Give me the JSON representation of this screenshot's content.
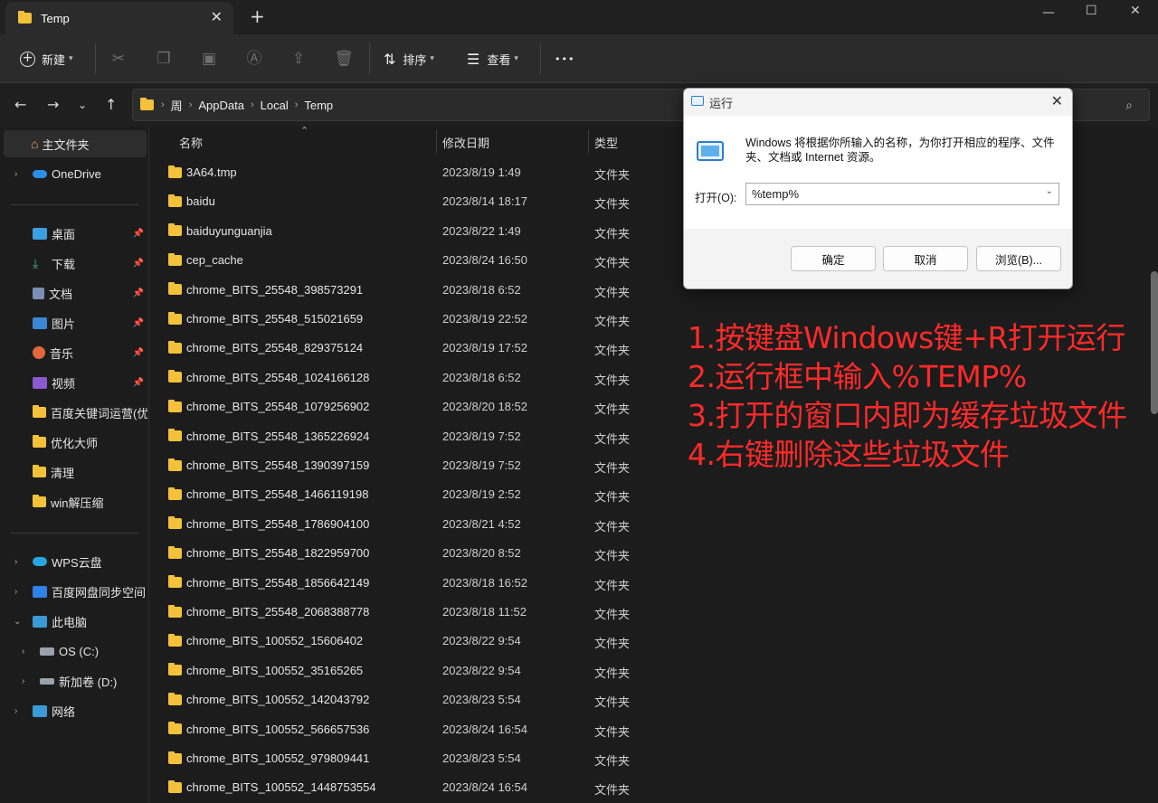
{
  "window": {
    "tab_title": "Temp",
    "tab_close": "✕",
    "new_tab": "+",
    "minimize": "—",
    "maximize": "☐",
    "close": "✕"
  },
  "toolbar": {
    "new_label": "新建",
    "sort_label": "排序",
    "view_label": "查看",
    "more": "•••"
  },
  "address": {
    "crumbs": [
      "周",
      "AppData",
      "Local",
      "Temp"
    ]
  },
  "sidebar": {
    "home": "主文件夹",
    "onedrive": "OneDrive",
    "quick": [
      "桌面",
      "下载",
      "文档",
      "图片",
      "音乐",
      "视频",
      "百度关键词运营(优化",
      "优化大师",
      "清理",
      "win解压缩"
    ],
    "wps": "WPS云盘",
    "baidu_sync": "百度网盘同步空间",
    "this_pc": "此电脑",
    "os_c": "OS (C:)",
    "new_vol": "新加卷 (D:)",
    "network": "网络"
  },
  "columns": {
    "name": "名称",
    "date": "修改日期",
    "type": "类型"
  },
  "files": [
    {
      "name": "3A64.tmp",
      "date": "2023/8/19 1:49",
      "type": "文件夹"
    },
    {
      "name": "baidu",
      "date": "2023/8/14 18:17",
      "type": "文件夹"
    },
    {
      "name": "baiduyunguanjia",
      "date": "2023/8/22 1:49",
      "type": "文件夹"
    },
    {
      "name": "cep_cache",
      "date": "2023/8/24 16:50",
      "type": "文件夹"
    },
    {
      "name": "chrome_BITS_25548_398573291",
      "date": "2023/8/18 6:52",
      "type": "文件夹"
    },
    {
      "name": "chrome_BITS_25548_515021659",
      "date": "2023/8/19 22:52",
      "type": "文件夹"
    },
    {
      "name": "chrome_BITS_25548_829375124",
      "date": "2023/8/19 17:52",
      "type": "文件夹"
    },
    {
      "name": "chrome_BITS_25548_1024166128",
      "date": "2023/8/18 6:52",
      "type": "文件夹"
    },
    {
      "name": "chrome_BITS_25548_1079256902",
      "date": "2023/8/20 18:52",
      "type": "文件夹"
    },
    {
      "name": "chrome_BITS_25548_1365226924",
      "date": "2023/8/19 7:52",
      "type": "文件夹"
    },
    {
      "name": "chrome_BITS_25548_1390397159",
      "date": "2023/8/19 7:52",
      "type": "文件夹"
    },
    {
      "name": "chrome_BITS_25548_1466119198",
      "date": "2023/8/19 2:52",
      "type": "文件夹"
    },
    {
      "name": "chrome_BITS_25548_1786904100",
      "date": "2023/8/21 4:52",
      "type": "文件夹"
    },
    {
      "name": "chrome_BITS_25548_1822959700",
      "date": "2023/8/20 8:52",
      "type": "文件夹"
    },
    {
      "name": "chrome_BITS_25548_1856642149",
      "date": "2023/8/18 16:52",
      "type": "文件夹"
    },
    {
      "name": "chrome_BITS_25548_2068388778",
      "date": "2023/8/18 11:52",
      "type": "文件夹"
    },
    {
      "name": "chrome_BITS_100552_15606402",
      "date": "2023/8/22 9:54",
      "type": "文件夹"
    },
    {
      "name": "chrome_BITS_100552_35165265",
      "date": "2023/8/22 9:54",
      "type": "文件夹"
    },
    {
      "name": "chrome_BITS_100552_142043792",
      "date": "2023/8/23 5:54",
      "type": "文件夹"
    },
    {
      "name": "chrome_BITS_100552_566657536",
      "date": "2023/8/24 16:54",
      "type": "文件夹"
    },
    {
      "name": "chrome_BITS_100552_979809441",
      "date": "2023/8/23 5:54",
      "type": "文件夹"
    },
    {
      "name": "chrome_BITS_100552_1448753554",
      "date": "2023/8/24 16:54",
      "type": "文件夹"
    }
  ],
  "run_dialog": {
    "title": "运行",
    "close": "✕",
    "description": "Windows 将根据你所输入的名称，为你打开相应的程序、文件夹、文档或 Internet 资源。",
    "open_label": "打开(O):",
    "input_value": "%temp%",
    "ok": "确定",
    "cancel": "取消",
    "browse": "浏览(B)..."
  },
  "annotation": [
    "1.按键盘Windows键+R打开运行",
    "2.运行框中输入%TEMP%",
    "3.打开的窗口内即为缓存垃圾文件",
    "4.右键删除这些垃圾文件"
  ],
  "colors": {
    "folder": "#f3c13a",
    "annotation": "#ff2a2a",
    "accent": "#2d7fc8"
  }
}
